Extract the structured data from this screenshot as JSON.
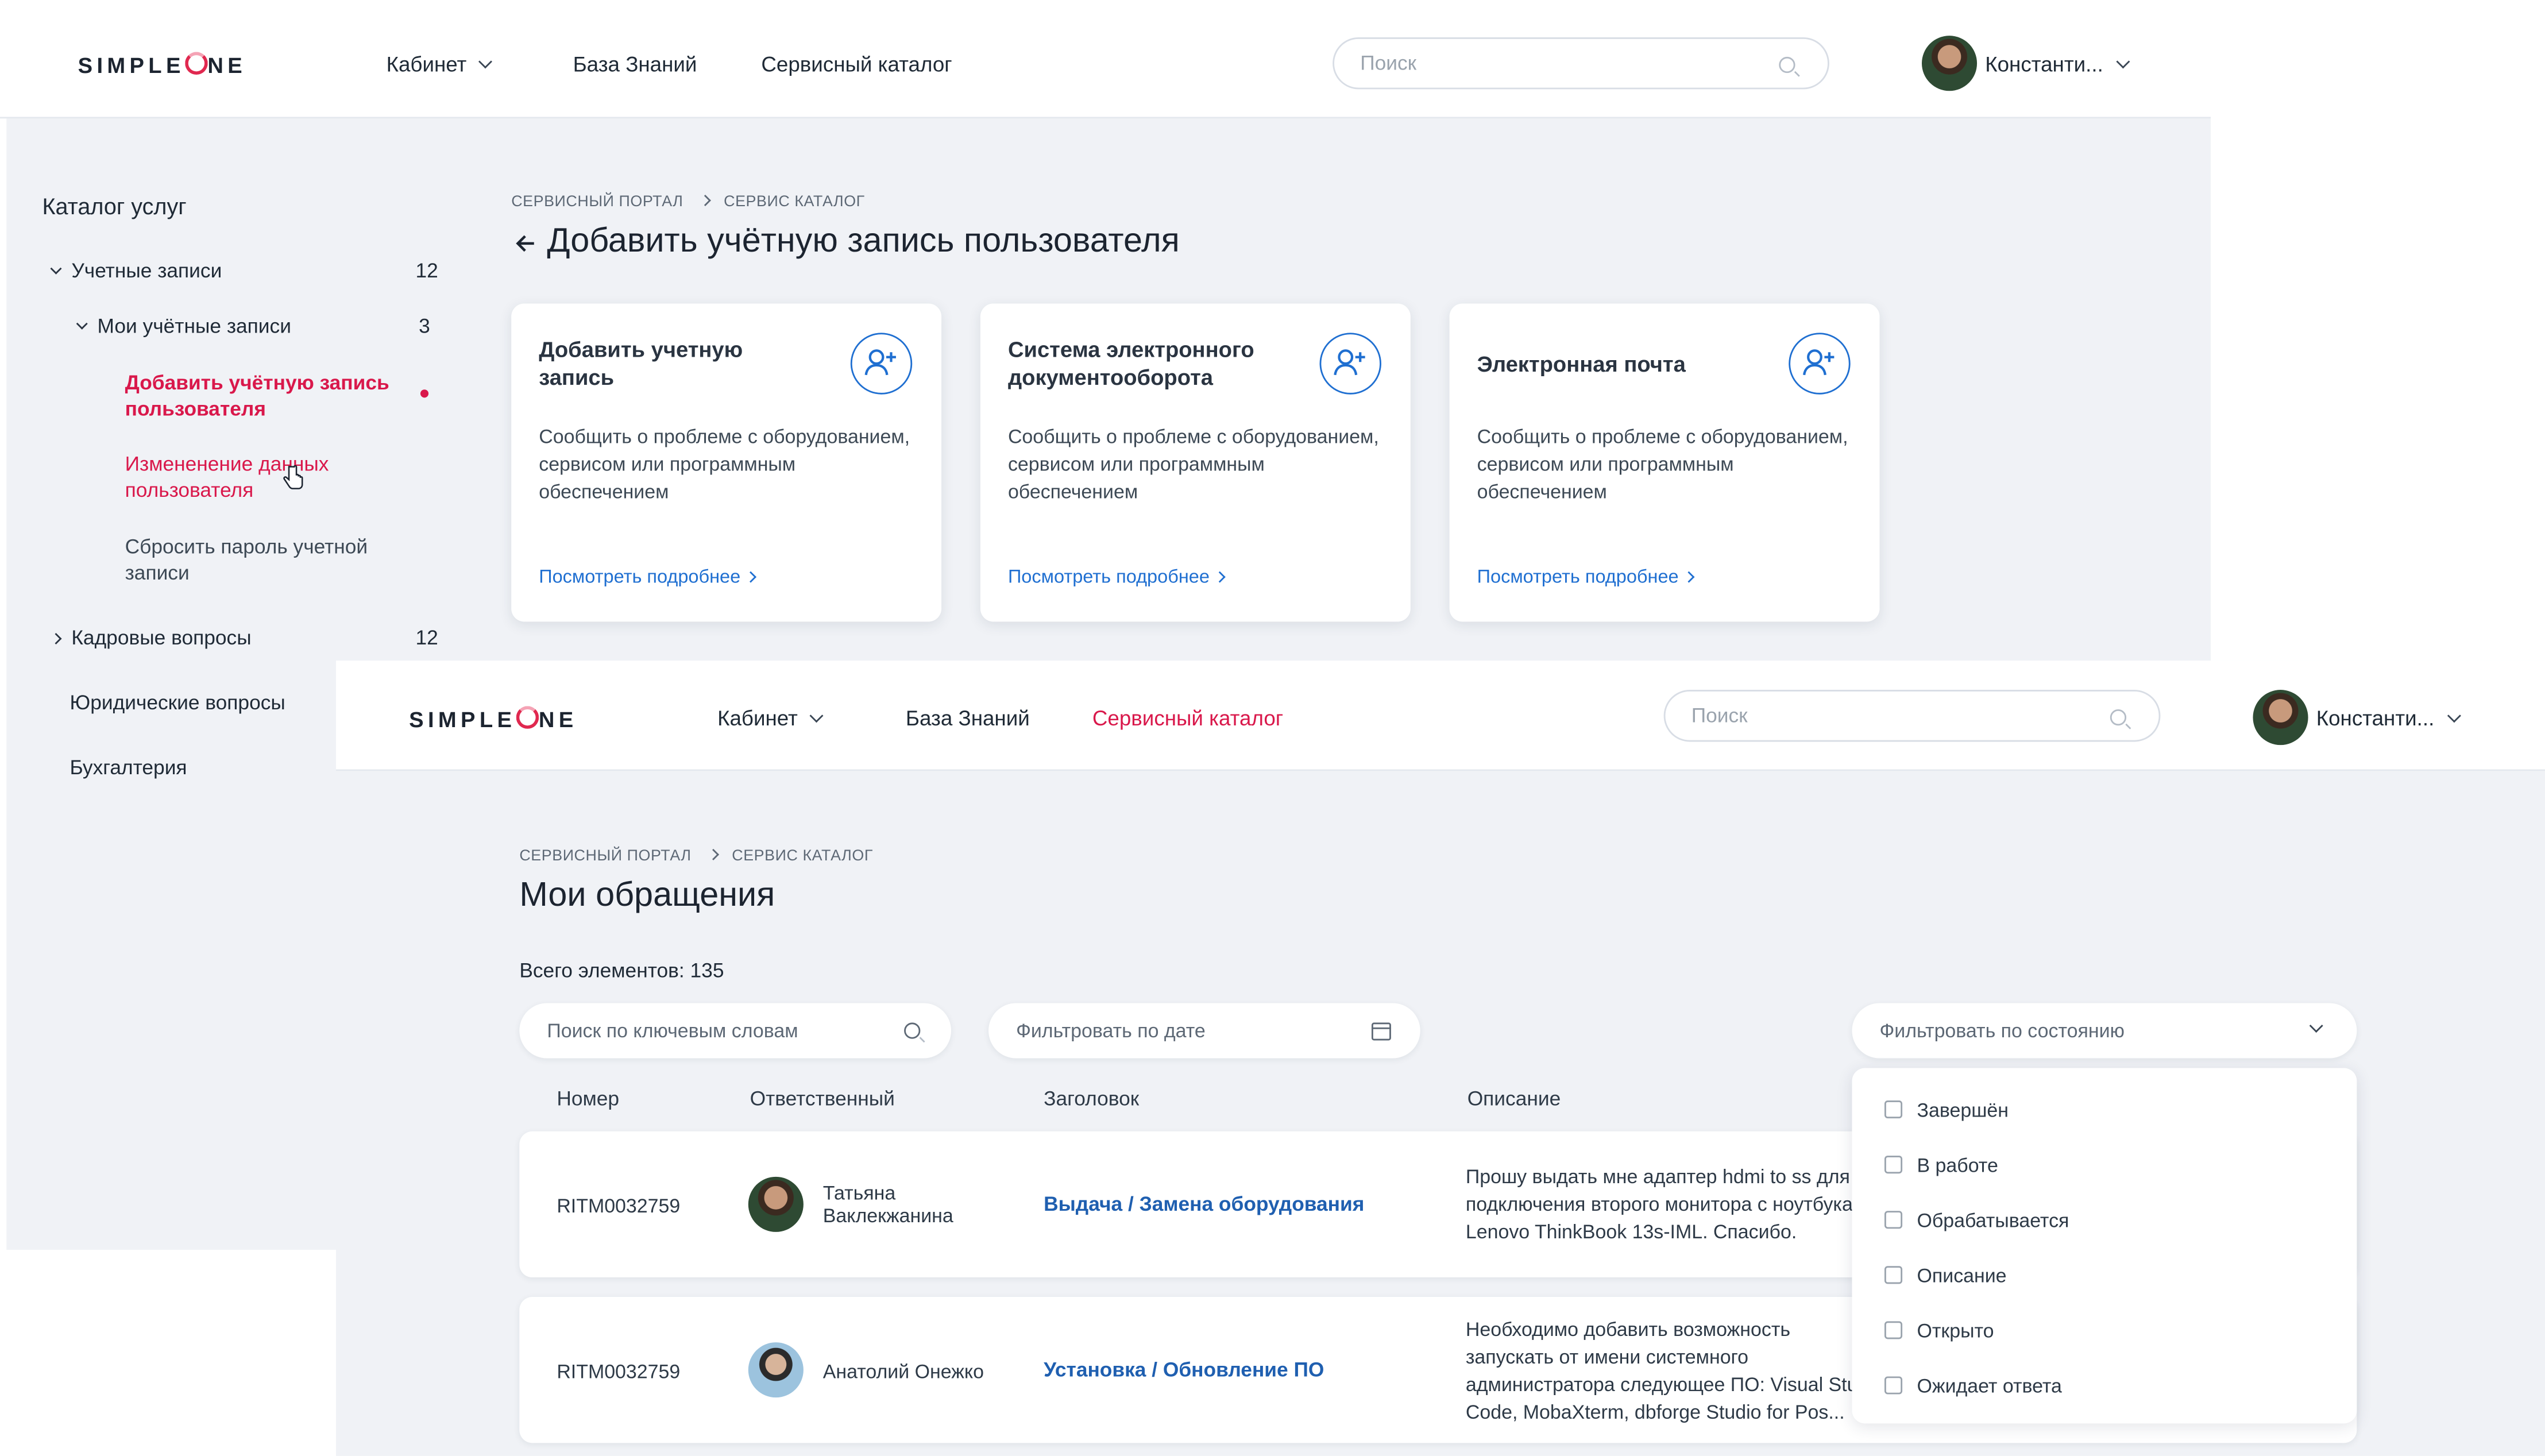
{
  "brand": {
    "logo_left": "SIMPLE",
    "logo_right": "NE"
  },
  "colors": {
    "accent": "#d9184b",
    "link": "#1f6fd1",
    "background": "#f0f2f6"
  },
  "screen1": {
    "nav": {
      "cabinet": "Кабинет",
      "knowledge": "База Знаний",
      "catalog": "Сервисный каталог"
    },
    "search_placeholder": "Поиск",
    "user_name": "Константи...",
    "sidebar": {
      "title": "Каталог услуг",
      "accounts": {
        "label": "Учетные записи",
        "count": "12"
      },
      "my_accounts": {
        "label": "Мои учётные записи",
        "count": "3"
      },
      "add_account": "Добавить учётную запись пользователя",
      "change_data": "Измененение данных пользователя",
      "reset_password": "Сбросить пароль учетной записи",
      "hr": {
        "label": "Кадровые вопросы",
        "count": "12"
      },
      "legal": "Юридические вопросы",
      "accounting": "Бухгалтерия"
    },
    "breadcrumb": {
      "first": "Сервисный портал",
      "second": "Сервис каталог"
    },
    "title": "Добавить учётную запись пользователя",
    "cards": [
      {
        "title": "Добавить учетную запись",
        "description": "Сообщить о проблеме с оборудованием, сервисом или программным обеспечением",
        "link": "Посмотреть подробнее",
        "icon": "add-user-icon"
      },
      {
        "title": "Система электронного документооборота",
        "description": "Сообщить о проблеме с оборудованием, сервисом или программным обеспечением",
        "link": "Посмотреть подробнее",
        "icon": "add-user-icon"
      },
      {
        "title": "Электронная почта",
        "description": "Сообщить о проблеме с оборудованием, сервисом или программным обеспечением",
        "link": "Посмотреть подробнее",
        "icon": "add-user-icon"
      }
    ]
  },
  "screen2": {
    "nav": {
      "cabinet": "Кабинет",
      "knowledge": "База Знаний",
      "catalog": "Сервисный каталог"
    },
    "search_placeholder": "Поиск",
    "user_name": "Константи...",
    "breadcrumb": {
      "first": "Сервисный портал",
      "second": "Сервис каталог"
    },
    "title": "Мои обращения",
    "total": "Всего элементов: 135",
    "keyword_placeholder": "Поиск по ключевым словам",
    "date_placeholder": "Фильтровать по дате",
    "state_placeholder": "Фильтровать по состоянию",
    "columns": {
      "number": "Номер",
      "responsible": "Ответственный",
      "heading": "Заголовок",
      "description": "Описание"
    },
    "rows": [
      {
        "number": "RITM0032759",
        "responsible": "Татьяна Ваклекжанина",
        "heading": "Выдача / Замена оборудования",
        "description_lines": [
          "Прошу выдать мне адаптер hdmi to ss для",
          "подключения второго монитора с ноутбука",
          "Lenovo ThinkBook 13s-IML. Спасибо."
        ]
      },
      {
        "number": "RITM0032759",
        "responsible": "Анатолий Онежко",
        "heading": "Установка / Обновление ПО",
        "description_lines": [
          "Необходимо добавить возможность",
          "запускать от имени системного",
          "администратора следующее ПО: Visual Studio",
          "Code, MobaXterm, dbforge Studio for Pos..."
        ]
      }
    ],
    "state_options": [
      "Завершён",
      "В работе",
      "Обрабатывается",
      "Описание",
      "Открыто",
      "Ожидает ответа"
    ]
  }
}
